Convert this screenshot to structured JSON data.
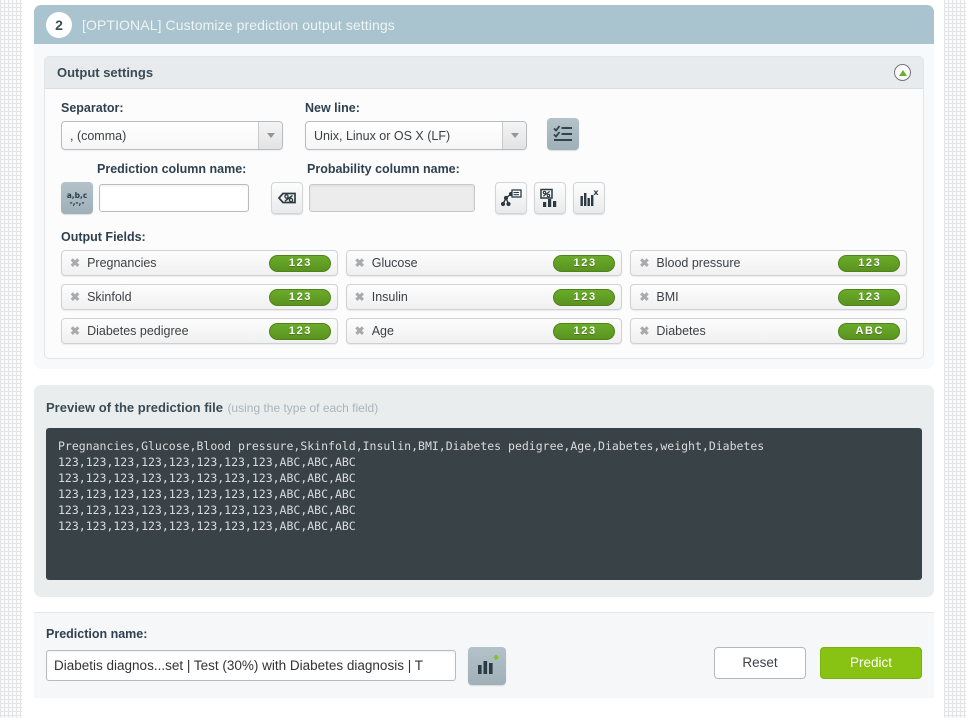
{
  "step": {
    "number": "2",
    "title": "[OPTIONAL] Customize prediction output settings"
  },
  "output_settings": {
    "panel_title": "Output settings",
    "collapse_icon": "collapse-up-icon",
    "separator": {
      "label": "Separator:",
      "value": ", (comma)"
    },
    "new_line": {
      "label": "New line:",
      "value": "Unix, Linux or OS X (LF)"
    },
    "header_toggle_icon": "checklist-icon",
    "prediction_column": {
      "label": "Prediction column name:",
      "icon": "abc-letters-icon",
      "value": "",
      "placeholder": ""
    },
    "probability_column": {
      "label": "Probability column name:",
      "icon": "percent-tag-icon",
      "value": "",
      "placeholder": ""
    },
    "extra_icons": [
      {
        "name": "decision-path-icon"
      },
      {
        "name": "importance-chart-icon"
      },
      {
        "name": "distribution-chart-icon"
      }
    ],
    "output_fields": {
      "label": "Output Fields:",
      "items": [
        {
          "name": "Pregnancies",
          "type": "123"
        },
        {
          "name": "Glucose",
          "type": "123"
        },
        {
          "name": "Blood pressure",
          "type": "123"
        },
        {
          "name": "Skinfold",
          "type": "123"
        },
        {
          "name": "Insulin",
          "type": "123"
        },
        {
          "name": "BMI",
          "type": "123"
        },
        {
          "name": "Diabetes pedigree",
          "type": "123"
        },
        {
          "name": "Age",
          "type": "123"
        },
        {
          "name": "Diabetes",
          "type": "ABC"
        }
      ],
      "remove_glyph": "✖"
    }
  },
  "preview": {
    "title": "Preview of the prediction file",
    "subtitle": "(using the type of each field)",
    "lines": [
      "Pregnancies,Glucose,Blood pressure,Skinfold,Insulin,BMI,Diabetes pedigree,Age,Diabetes,weight,Diabetes",
      "123,123,123,123,123,123,123,123,ABC,ABC,ABC",
      "123,123,123,123,123,123,123,123,ABC,ABC,ABC",
      "123,123,123,123,123,123,123,123,ABC,ABC,ABC",
      "123,123,123,123,123,123,123,123,ABC,ABC,ABC",
      "123,123,123,123,123,123,123,123,ABC,ABC,ABC"
    ]
  },
  "bottom": {
    "prediction_name": {
      "label": "Prediction name:",
      "value": "Diabetis diagnos...set | Test (30%) with Diabetes diagnosis | T",
      "placeholder": ""
    },
    "add_chart_icon": "add-chart-icon",
    "reset_label": "Reset",
    "predict_label": "Predict"
  },
  "colors": {
    "step_header": "#a9c4ce",
    "badge_green": "#5a9320",
    "predict_green": "#88c212",
    "preview_bg": "#394347"
  }
}
